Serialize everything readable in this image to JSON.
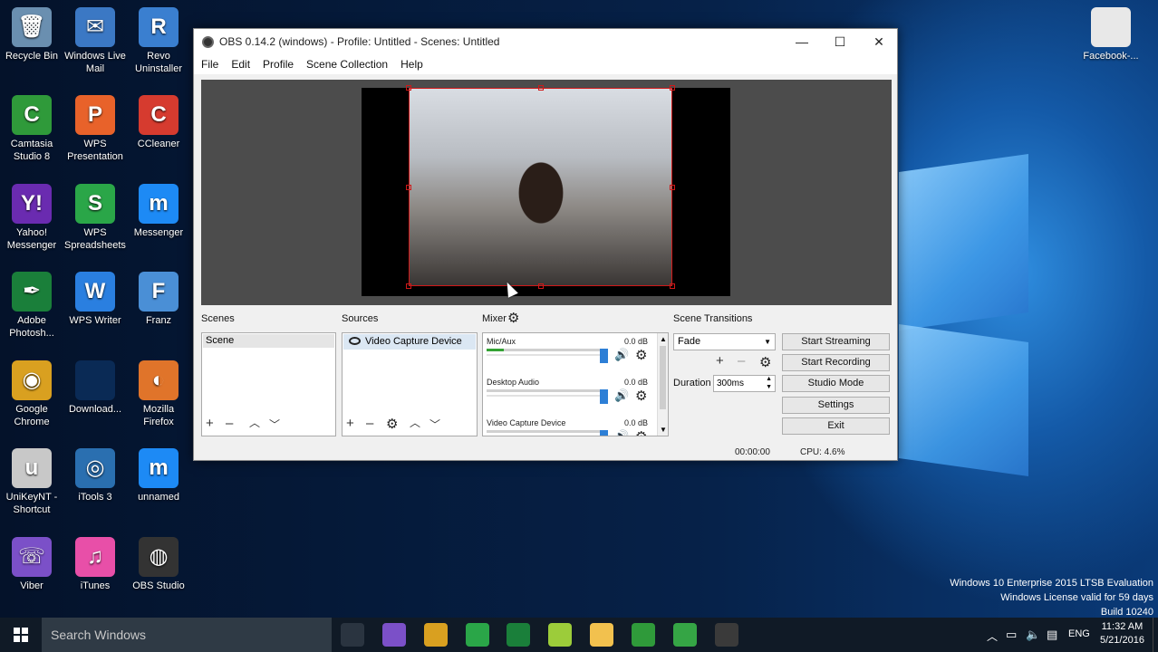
{
  "desktop_icons": [
    {
      "label": "Recycle Bin",
      "glyph": "🗑",
      "color": "#6a8fb0"
    },
    {
      "label": "Windows Live Mail",
      "glyph": "✉",
      "color": "#3b78c4"
    },
    {
      "label": "Revo Uninstaller",
      "glyph": "R",
      "color": "#3a7fd0"
    },
    {
      "label": "Camtasia Studio 8",
      "glyph": "C",
      "color": "#2f9a3a"
    },
    {
      "label": "WPS Presentation",
      "glyph": "P",
      "color": "#e8622a"
    },
    {
      "label": "CCleaner",
      "glyph": "C",
      "color": "#d63b2f"
    },
    {
      "label": "Yahoo! Messenger",
      "glyph": "Y!",
      "color": "#6a2bb0"
    },
    {
      "label": "WPS Spreadsheets",
      "glyph": "S",
      "color": "#2aa648"
    },
    {
      "label": "Messenger",
      "glyph": "m",
      "color": "#1d8af5"
    },
    {
      "label": "Adobe Photosh...",
      "glyph": "✒",
      "color": "#1a7f3a"
    },
    {
      "label": "WPS Writer",
      "glyph": "W",
      "color": "#2a7fe0"
    },
    {
      "label": "Franz",
      "glyph": "F",
      "color": "#4a8fd6"
    },
    {
      "label": "Google Chrome",
      "glyph": "◉",
      "color": "#d9a020"
    },
    {
      "label": "Download...",
      "glyph": "",
      "color": "#0a2a55"
    },
    {
      "label": "Mozilla Firefox",
      "glyph": "◐",
      "color": "#e0742a"
    },
    {
      "label": "UniKeyNT - Shortcut",
      "glyph": "u",
      "color": "#c8c8c8"
    },
    {
      "label": "iTools 3",
      "glyph": "◎",
      "color": "#2a6fb0"
    },
    {
      "label": "unnamed",
      "glyph": "m",
      "color": "#1d8af5"
    },
    {
      "label": "Viber",
      "glyph": "☏",
      "color": "#7b50c8"
    },
    {
      "label": "iTunes",
      "glyph": "♫",
      "color": "#e84fa8"
    },
    {
      "label": "OBS Studio",
      "glyph": "◍",
      "color": "#333333"
    },
    {
      "label": "Facebook-...",
      "glyph": "",
      "color": "#e8e8e8"
    }
  ],
  "obs": {
    "title": "OBS 0.14.2 (windows) - Profile: Untitled - Scenes: Untitled",
    "window_controls": {
      "minimize": "—",
      "maximize": "☐",
      "close": "✕"
    },
    "menu": [
      "File",
      "Edit",
      "Profile",
      "Scene Collection",
      "Help"
    ],
    "docks": {
      "scenes_title": "Scenes",
      "sources_title": "Sources",
      "mixer_title": "Mixer",
      "transitions_title": "Scene Transitions"
    },
    "scenes": [
      "Scene"
    ],
    "sources": [
      "Video Capture Device"
    ],
    "mixer": [
      {
        "name": "Mic/Aux",
        "db": "0.0 dB",
        "level": 0.15,
        "volume": 1.0
      },
      {
        "name": "Desktop Audio",
        "db": "0.0 dB",
        "level": 0.0,
        "volume": 1.0
      },
      {
        "name": "Video Capture Device",
        "db": "0.0 dB",
        "level": 0.0,
        "volume": 1.0
      }
    ],
    "transition": {
      "selected": "Fade",
      "duration_label": "Duration",
      "duration_value": "300ms"
    },
    "buttons": {
      "start_streaming": "Start Streaming",
      "start_recording": "Start Recording",
      "studio_mode": "Studio Mode",
      "settings": "Settings",
      "exit": "Exit"
    },
    "status": {
      "time": "00:00:00",
      "cpu": "CPU: 4.6%"
    }
  },
  "taskbar": {
    "search_placeholder": "Search Windows",
    "apps": [
      {
        "name": "task-view",
        "color": "#2a3440"
      },
      {
        "name": "viber",
        "color": "#7b50c8"
      },
      {
        "name": "chrome",
        "color": "#d9a020"
      },
      {
        "name": "wps-spreadsheets",
        "color": "#2aa648"
      },
      {
        "name": "photoshop",
        "color": "#1a7f3a"
      },
      {
        "name": "folder-green",
        "color": "#9ccc3a"
      },
      {
        "name": "file-explorer",
        "color": "#f2c14e"
      },
      {
        "name": "camtasia",
        "color": "#2f9a3a"
      },
      {
        "name": "camtasia-2",
        "color": "#35a545"
      },
      {
        "name": "obs",
        "color": "#3a3a3a"
      }
    ],
    "tray": {
      "lang": "ENG",
      "time": "11:32 AM",
      "date": "5/21/2016"
    }
  },
  "watermark": [
    "Windows 10 Enterprise 2015 LTSB Evaluation",
    "Windows License valid for 59 days",
    "Build 10240"
  ]
}
